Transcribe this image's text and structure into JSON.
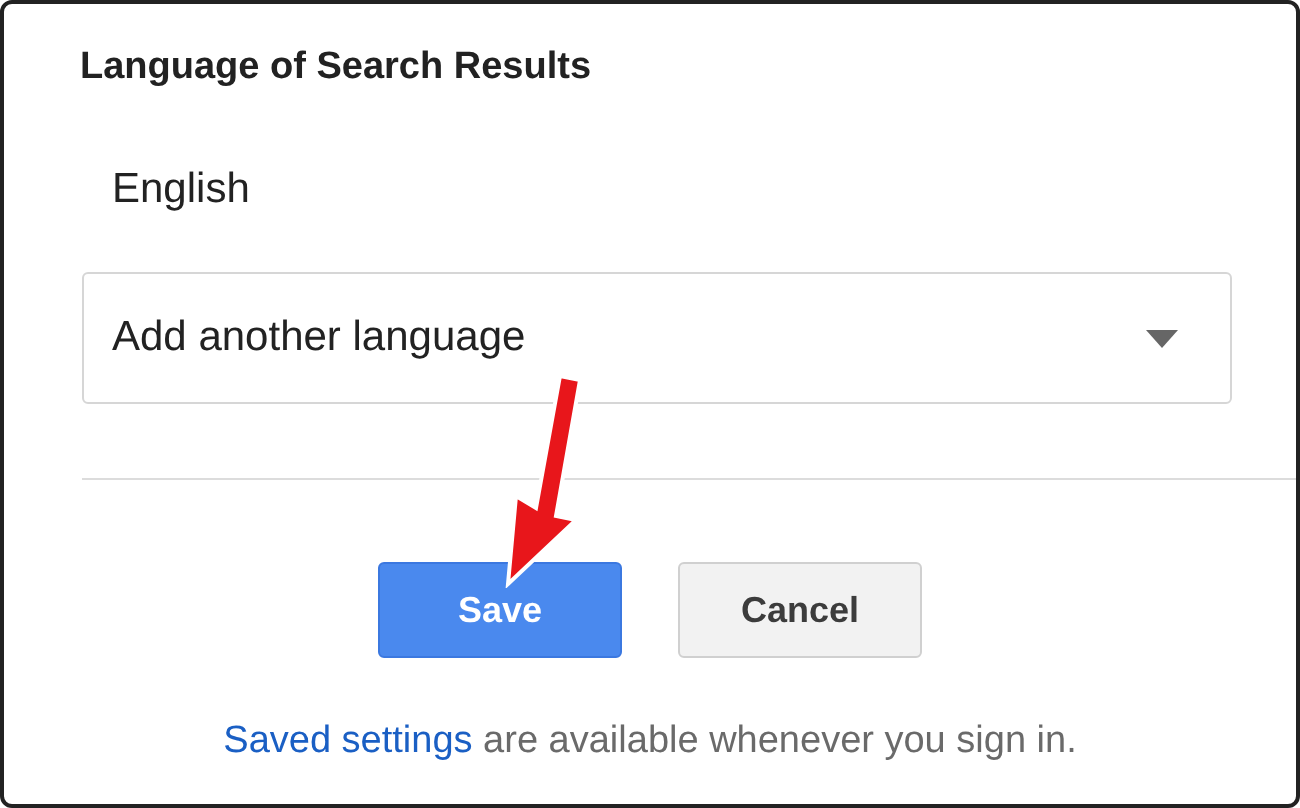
{
  "section_title": "Language of Search Results",
  "current_language": "English",
  "language_dropdown": {
    "value": "Add another language"
  },
  "buttons": [
    {
      "label": "Save",
      "kind": "primary"
    },
    {
      "label": "Cancel",
      "kind": "secondary"
    }
  ],
  "footer": {
    "link": "Saved settings",
    "text": " are available whenever you sign in."
  }
}
